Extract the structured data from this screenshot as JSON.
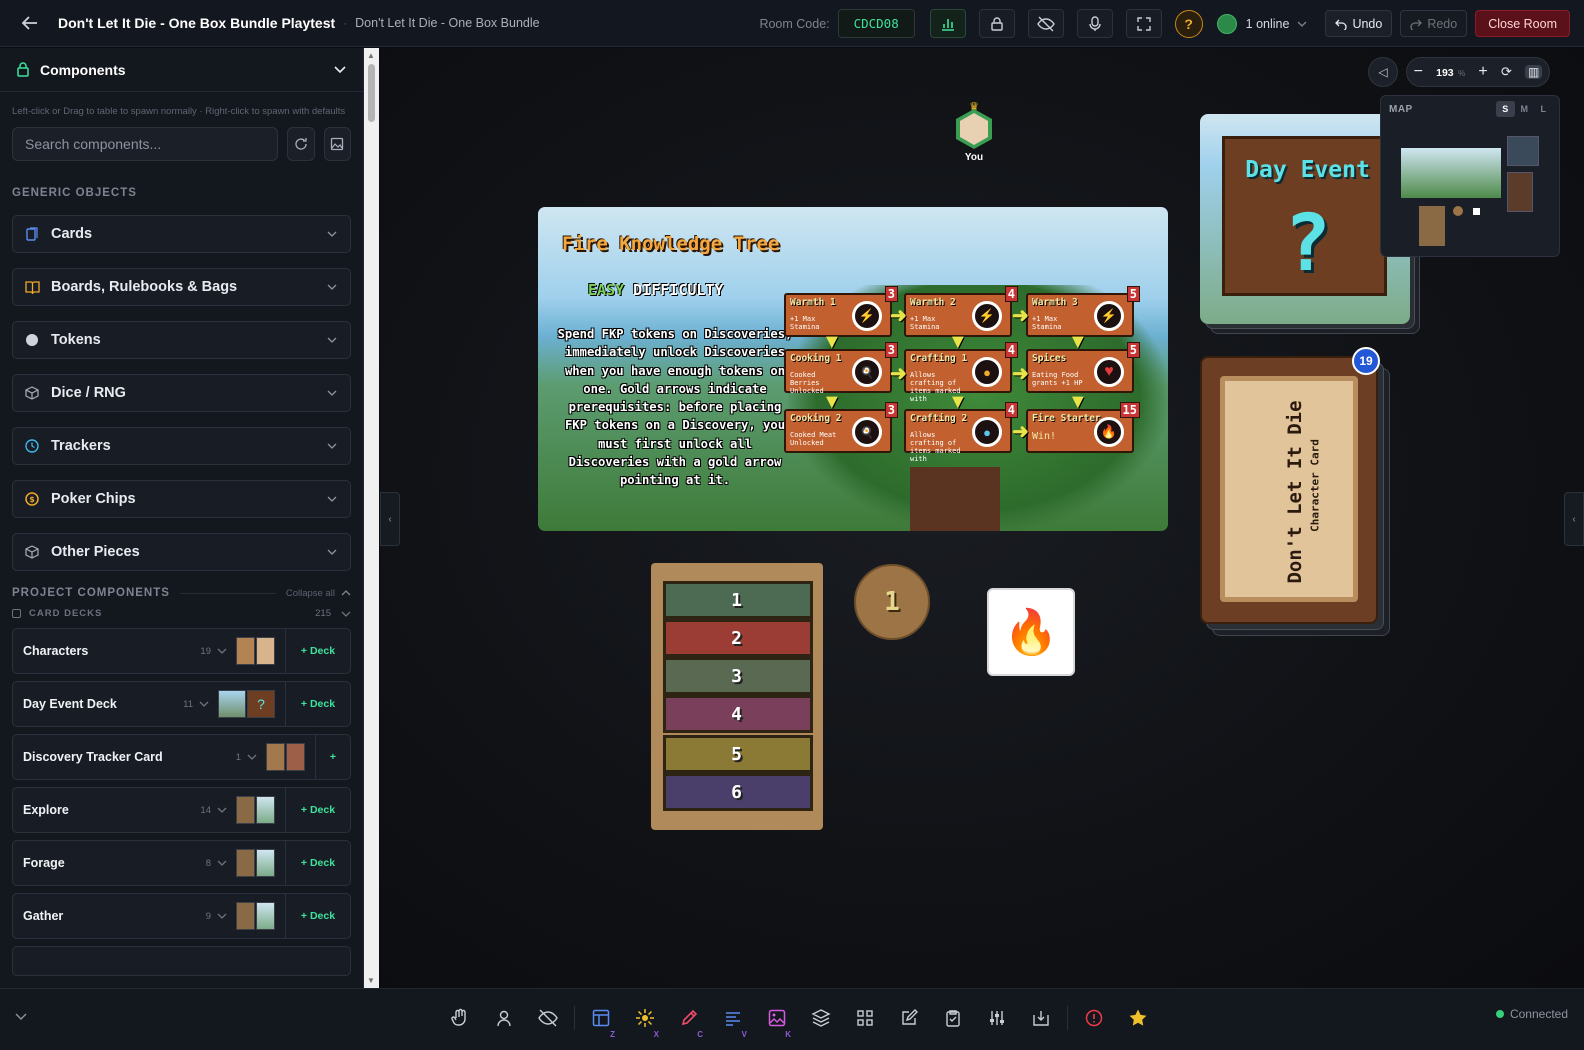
{
  "topbar": {
    "title": "Don't Let It Die - One Box Bundle Playtest",
    "separator": "·",
    "subtitle": "Don't Let It Die - One Box Bundle",
    "room_code_label": "Room Code:",
    "room_code": "CDCD08",
    "help": "?",
    "online": "1 online",
    "undo": "Undo",
    "redo": "Redo",
    "close_room": "Close Room"
  },
  "sidebar": {
    "header": "Components",
    "hint": "Left-click or Drag to table to spawn normally · Right-click to spawn with defaults",
    "search_placeholder": "Search components...",
    "generic_title": "GENERIC OBJECTS",
    "generic": [
      {
        "label": "Cards",
        "icon": "cards-icon"
      },
      {
        "label": "Boards, Rulebooks & Bags",
        "icon": "book-icon"
      },
      {
        "label": "Tokens",
        "icon": "token-icon"
      },
      {
        "label": "Dice / RNG",
        "icon": "dice-icon"
      },
      {
        "label": "Trackers",
        "icon": "clock-icon"
      },
      {
        "label": "Poker Chips",
        "icon": "chip-icon"
      },
      {
        "label": "Other Pieces",
        "icon": "cube-icon"
      }
    ],
    "project_title": "PROJECT COMPONENTS",
    "collapse_all": "Collapse all",
    "card_decks_label": "CARD DECKS",
    "card_decks_count": "215",
    "decks": [
      {
        "name": "Characters",
        "count": "19",
        "action": "Deck"
      },
      {
        "name": "Day Event Deck",
        "count": "11",
        "action": "Deck"
      },
      {
        "name": "Discovery Tracker Card",
        "count": "1",
        "action": ""
      },
      {
        "name": "Explore",
        "count": "14",
        "action": "Deck"
      },
      {
        "name": "Forage",
        "count": "8",
        "action": "Deck"
      },
      {
        "name": "Gather",
        "count": "9",
        "action": "Deck"
      }
    ]
  },
  "table": {
    "player_label": "You",
    "zoom": "193",
    "zoom_unit": "%",
    "map_label": "MAP",
    "map_sizes": [
      "S",
      "M",
      "L"
    ],
    "deck_badge": "19",
    "board": {
      "title": "Fire Knowledge Tree",
      "difficulty_word": "EASY",
      "difficulty_label": "DIFFICULTY",
      "rules_text": "Spend FKP tokens on Discoveries, immediately unlock Discoveries when you have enough tokens on one. Gold arrows indicate prerequisites: before placing FKP tokens on a Discovery, you must first unlock all Discoveries with a gold arrow pointing at it.",
      "nodes": [
        {
          "label": "Warmth 1",
          "sub": "+1 Max Stamina",
          "cost": "3",
          "glyph": "⚡"
        },
        {
          "label": "Warmth 2",
          "sub": "+1 Max Stamina",
          "cost": "4",
          "glyph": "⚡"
        },
        {
          "label": "Warmth 3",
          "sub": "+1 Max Stamina",
          "cost": "5",
          "glyph": "⚡"
        },
        {
          "label": "Cooking 1",
          "sub": "Cooked Berries Unlocked",
          "cost": "3",
          "glyph": "🍳"
        },
        {
          "label": "Crafting 1",
          "sub": "Allows crafting of items marked with",
          "cost": "4",
          "glyph": "●"
        },
        {
          "label": "Spices",
          "sub": "Eating Food grants +1 HP",
          "cost": "5",
          "glyph": "♥"
        },
        {
          "label": "Cooking 2",
          "sub": "Cooked Meat Unlocked",
          "cost": "3",
          "glyph": "🍳"
        },
        {
          "label": "Crafting 2",
          "sub": "Allows crafting of items marked with",
          "cost": "4",
          "glyph": "●"
        },
        {
          "label": "Fire Starter",
          "sub": "Win!",
          "cost": "15",
          "glyph": "🔥"
        }
      ]
    },
    "tracker_numbers": [
      "1",
      "2",
      "3",
      "4",
      "5",
      "6"
    ],
    "token_value": "1",
    "day_event_title": "Day Event",
    "day_event_mark": "?",
    "character_title": "Don't Let It Die",
    "character_subtitle": "Character Card"
  },
  "bottombar": {
    "tools": [
      {
        "name": "hand-tool",
        "key": ""
      },
      {
        "name": "player-tool",
        "key": ""
      },
      {
        "name": "hide-tool",
        "key": ""
      },
      {
        "name": "layout-tool",
        "key": "Z"
      },
      {
        "name": "spotlight-tool",
        "key": "X"
      },
      {
        "name": "pen-tool",
        "key": "C"
      },
      {
        "name": "text-tool",
        "key": "V"
      },
      {
        "name": "image-tool",
        "key": "K"
      },
      {
        "name": "layers-tool",
        "key": ""
      },
      {
        "name": "grid-tool",
        "key": ""
      },
      {
        "name": "notes-tool",
        "key": ""
      },
      {
        "name": "clipboard-tool",
        "key": ""
      },
      {
        "name": "settings-tool",
        "key": ""
      },
      {
        "name": "export-tool",
        "key": ""
      },
      {
        "name": "alert-tool",
        "key": ""
      },
      {
        "name": "favorite-tool",
        "key": ""
      }
    ],
    "status": "Connected"
  },
  "colors": {
    "accent_green": "#3ee29b",
    "close_red": "#5a1119",
    "badge_blue": "#2257d6"
  }
}
